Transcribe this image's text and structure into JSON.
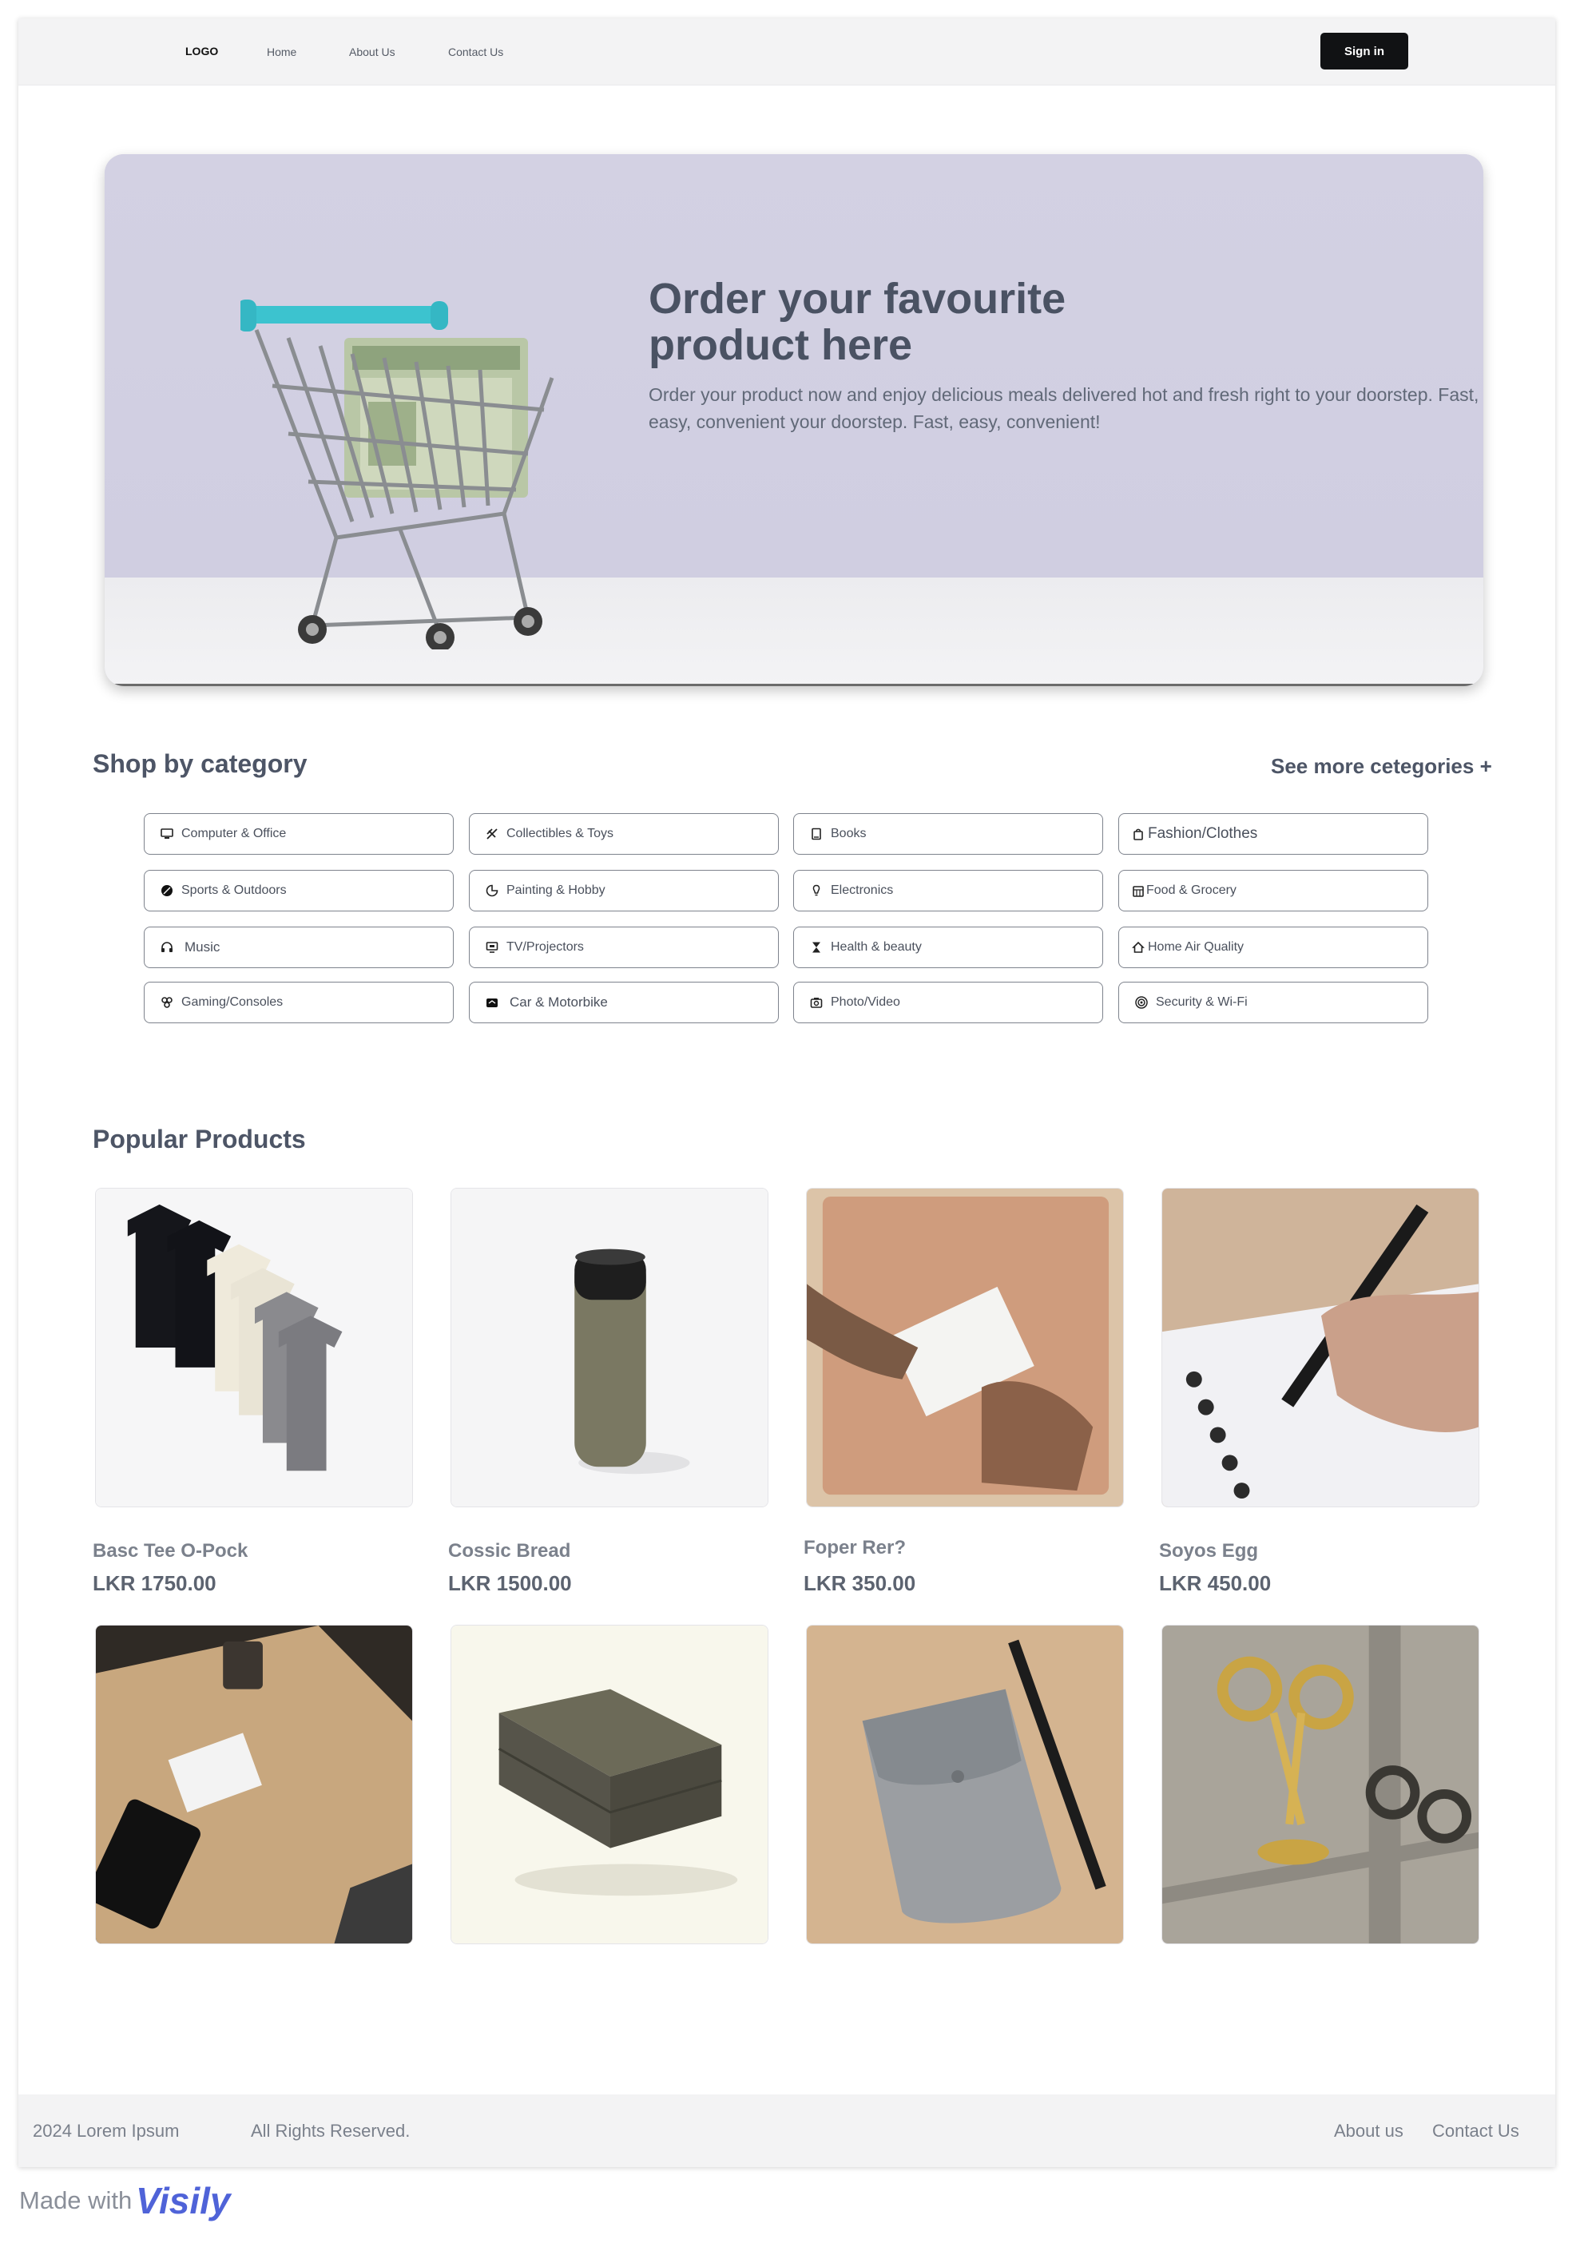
{
  "nav": {
    "logo": "LOGO",
    "links": [
      "Home",
      "About Us",
      "Contact Us"
    ],
    "signin": "Sign in"
  },
  "hero": {
    "title": "Order your favourite product here",
    "subtitle": "Order your product now and enjoy delicious meals delivered hot and fresh right to your doorstep. Fast, easy, convenient your doorstep. Fast, easy, convenient!"
  },
  "categories": {
    "title": "Shop by category",
    "see_more": "See more cetegories +",
    "items": [
      {
        "label": "Computer & Office",
        "icon": "computer-icon"
      },
      {
        "label": "Collectibles & Toys",
        "icon": "toys-icon"
      },
      {
        "label": "Books",
        "icon": "book-icon"
      },
      {
        "label": "Fashion/Clothes",
        "icon": "bag-icon"
      },
      {
        "label": "Sports & Outdoors",
        "icon": "ball-icon"
      },
      {
        "label": "Painting & Hobby",
        "icon": "palette-icon"
      },
      {
        "label": "Electronics",
        "icon": "bulb-icon"
      },
      {
        "label": "Food & Grocery",
        "icon": "grocery-icon"
      },
      {
        "label": "Music",
        "icon": "headphones-icon"
      },
      {
        "label": "TV/Projectors",
        "icon": "tv-icon"
      },
      {
        "label": "Health & beauty",
        "icon": "hourglass-icon"
      },
      {
        "label": "Home Air Quality",
        "icon": "home-icon"
      },
      {
        "label": "Gaming/Consoles",
        "icon": "gaming-icon"
      },
      {
        "label": "Car & Motorbike",
        "icon": "car-icon"
      },
      {
        "label": "Photo/Video",
        "icon": "camera-icon"
      },
      {
        "label": "Security & Wi-Fi",
        "icon": "wifi-icon"
      }
    ]
  },
  "popular": {
    "title": "Popular Products",
    "products": [
      {
        "name": "Basc Tee O-Pock",
        "price": "LKR 1750.00"
      },
      {
        "name": "Cossic Bread",
        "price": "LKR 1500.00"
      },
      {
        "name": "Foper Rer?",
        "price": "LKR 350.00"
      },
      {
        "name": "Soyos Egg",
        "price": "LKR 450.00"
      }
    ]
  },
  "footer": {
    "copyright": "2024 Lorem Ipsum",
    "rights": "All Rights Reserved.",
    "about": "About us",
    "contact": "Contact Us"
  },
  "badge": {
    "made_with": "Made with",
    "brand": "Visily"
  }
}
